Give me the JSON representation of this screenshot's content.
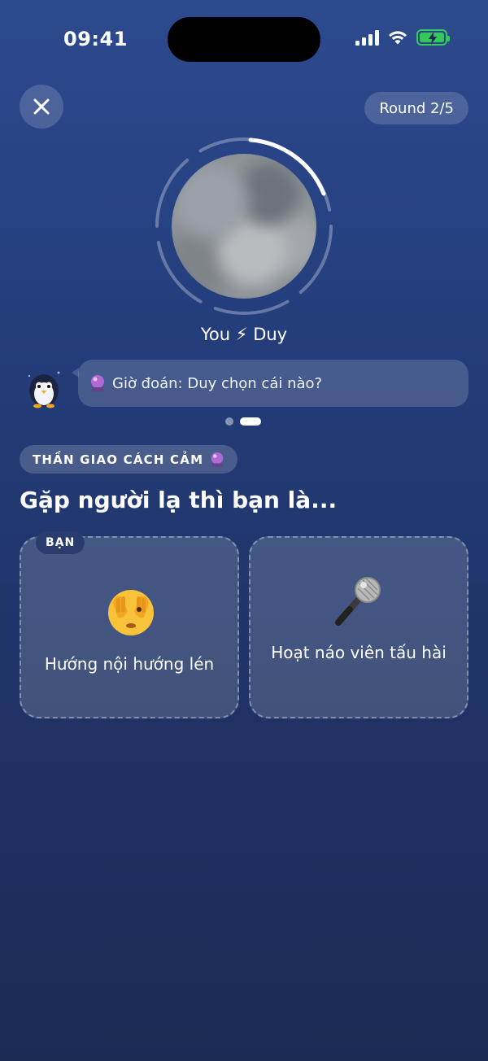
{
  "status": {
    "time": "09:41"
  },
  "header": {
    "round": "Round 2/5"
  },
  "match": {
    "you": "You",
    "bolt": "⚡",
    "partner": "Duy"
  },
  "prompt": {
    "text": "Giờ đoán: Duy chọn cái nào?"
  },
  "category": {
    "label": "THẦN GIAO CÁCH CẢM"
  },
  "question": {
    "text": "Gặp người lạ thì bạn là..."
  },
  "options": [
    {
      "tag": "BẠN",
      "text": "Hướng nội hướng lén",
      "icon": "see-no-evil-face-icon"
    },
    {
      "text": "Hoạt náo viên tấu hài",
      "icon": "microphone-icon"
    }
  ],
  "colors": {
    "bg_top": "#2d4a8e",
    "bg_bottom": "#1c2b56",
    "battery": "#34c759"
  }
}
